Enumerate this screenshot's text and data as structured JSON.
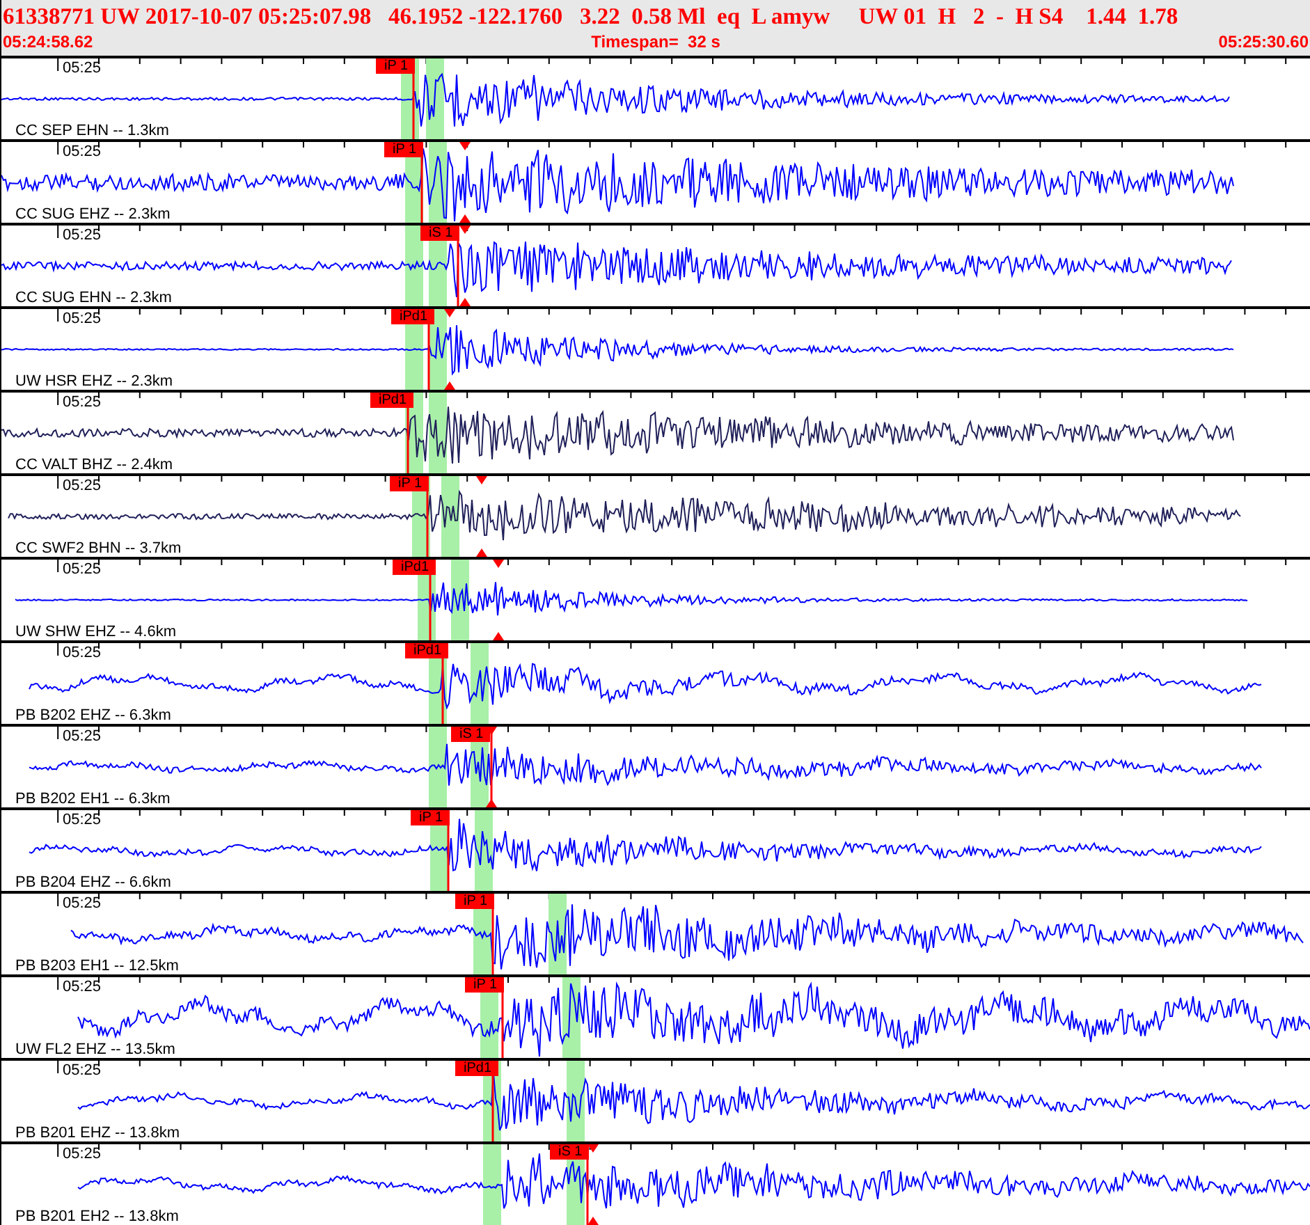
{
  "header": {
    "event_line": "61338771 UW 2017-10-07 05:25:07.98   46.1952 -122.1760   3.22  0.58 Ml  eq  L amyw     UW 01  H   2  -  H S4    1.44  1.78",
    "start_time": "05:24:58.62",
    "timespan": "Timespan=  32 s",
    "end_time": "05:25:30.60"
  },
  "traces": [
    {
      "time_label": "05:25",
      "station": "CC SEP EHN -- 1.3km",
      "color": "#0000ff",
      "picks": [
        {
          "label": "iP 1"
        }
      ]
    },
    {
      "time_label": "05:25",
      "station": "CC SUG EHZ -- 2.3km",
      "color": "#0000ff",
      "picks": [
        {
          "label": "iP 1"
        }
      ]
    },
    {
      "time_label": "05:25",
      "station": "CC SUG EHN -- 2.3km",
      "color": "#0000ff",
      "picks": [
        {
          "label": "iS 1"
        }
      ]
    },
    {
      "time_label": "05:25",
      "station": "UW HSR EHZ -- 2.3km",
      "color": "#0000ff",
      "picks": [
        {
          "label": "iPd1"
        }
      ]
    },
    {
      "time_label": "05:25",
      "station": "CC VALT BHZ -- 2.4km",
      "color": "#20205a",
      "picks": [
        {
          "label": "iPd1"
        }
      ]
    },
    {
      "time_label": "05:25",
      "station": "CC SWF2 BHN -- 3.7km",
      "color": "#20205a",
      "picks": [
        {
          "label": "iP 1"
        }
      ]
    },
    {
      "time_label": "05:25",
      "station": "UW SHW EHZ -- 4.6km",
      "color": "#0000ff",
      "picks": [
        {
          "label": "iPd1"
        }
      ]
    },
    {
      "time_label": "05:25",
      "station": "PB B202 EHZ -- 6.3km",
      "color": "#0000ff",
      "picks": [
        {
          "label": "iPd1"
        }
      ]
    },
    {
      "time_label": "05:25",
      "station": "PB B202 EH1 -- 6.3km",
      "color": "#0000ff",
      "picks": [
        {
          "label": "iS 1"
        }
      ]
    },
    {
      "time_label": "05:25",
      "station": "PB B204 EHZ -- 6.6km",
      "color": "#0000ff",
      "picks": [
        {
          "label": "iP 1"
        }
      ]
    },
    {
      "time_label": "05:25",
      "station": "PB B203 EH1 -- 12.5km",
      "color": "#0000ff",
      "picks": [
        {
          "label": "iP 1"
        }
      ]
    },
    {
      "time_label": "05:25",
      "station": "UW FL2 EHZ -- 13.5km",
      "color": "#0000ff",
      "picks": [
        {
          "label": "iP 1"
        }
      ]
    },
    {
      "time_label": "05:25",
      "station": "PB B201 EHZ -- 13.8km",
      "color": "#0000ff",
      "picks": [
        {
          "label": "iPd1"
        }
      ]
    },
    {
      "time_label": "05:25",
      "station": "PB B201 EH2 -- 13.8km",
      "color": "#0000ff",
      "picks": [
        {
          "label": "iS 1"
        }
      ]
    }
  ]
}
